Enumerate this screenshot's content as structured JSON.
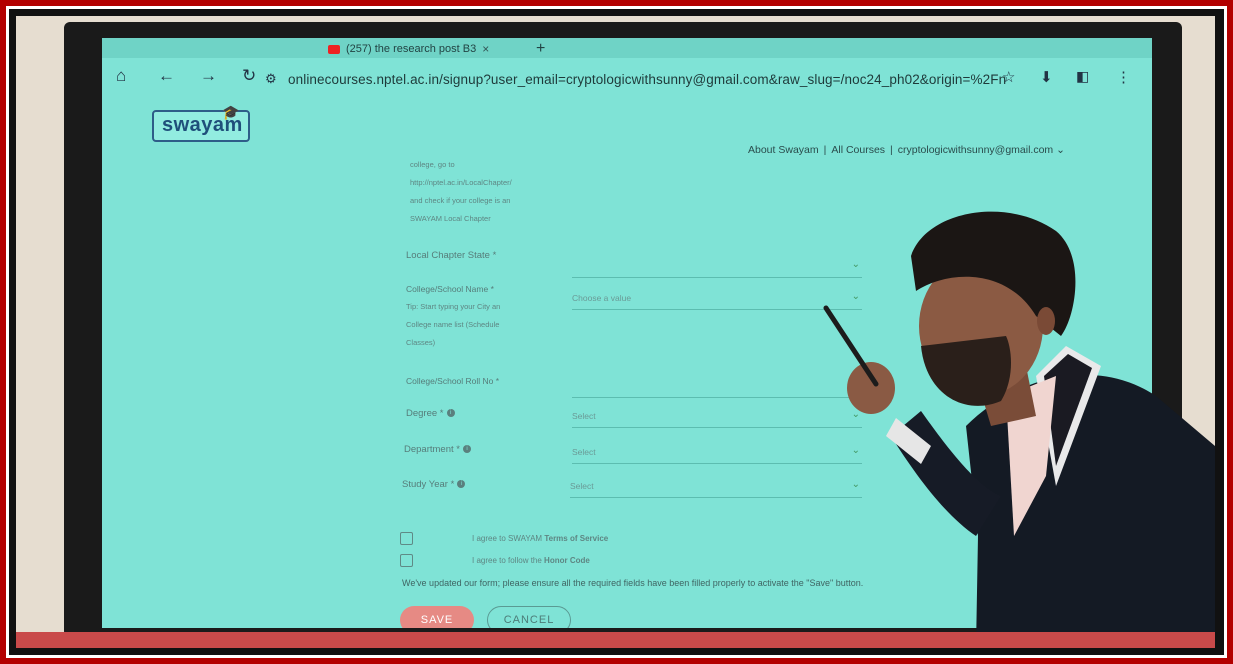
{
  "browser": {
    "tabs": [
      {
        "label": "(257) the research post B3"
      }
    ],
    "url": "onlinecourses.nptel.ac.in/signup?user_email=cryptologicwithsunny@gmail.com&raw_slug=/noc24_ph02&origin=%2Fn"
  },
  "site": {
    "logo_text": "swayam",
    "nav": {
      "about": "About Swayam",
      "all_courses": "All Courses",
      "account": "cryptologicwithsunny@gmail.com"
    }
  },
  "form": {
    "chapter_hint": [
      "college, go to",
      "http://nptel.ac.in/LocalChapter/",
      "and check if your college is an",
      "SWAYAM Local Chapter"
    ],
    "local_chapter_state_label": "Local Chapter State *",
    "college_name_label": "College/School Name *",
    "college_name_hint": [
      "Tip: Start typing your City an",
      "College name list (Schedule",
      "Classes)"
    ],
    "college_name_placeholder": "Choose a value",
    "roll_no_label": "College/School Roll No *",
    "degree_label": "Degree *",
    "degree_value": "Select",
    "department_label": "Department *",
    "department_value": "Select",
    "study_year_label": "Study Year *",
    "study_year_value": "Select",
    "terms": {
      "prefix": "I agree to SWAYAM ",
      "link": "Terms of Service"
    },
    "honor": {
      "prefix": "I agree to follow the ",
      "link": "Honor Code"
    },
    "notice": "We've updated our form; please ensure all the required fields have been filled properly to activate the \"Save\" button.",
    "save_label": "SAVE",
    "cancel_label": "CANCEL"
  },
  "colors": {
    "screen": "#7fe3d6",
    "frame": "#b30000",
    "save_button": "#e68a84"
  }
}
